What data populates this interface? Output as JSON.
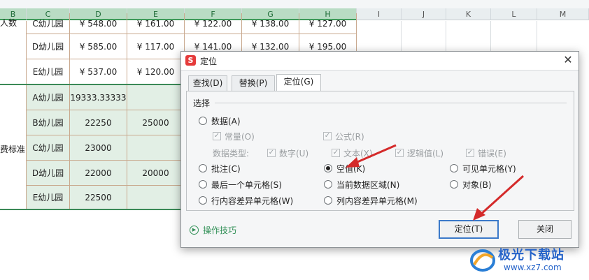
{
  "sheet": {
    "columns": [
      "B",
      "C",
      "D",
      "E",
      "F",
      "G",
      "H",
      "I",
      "J",
      "K",
      "L",
      "M"
    ],
    "group1_label": "人数",
    "group2_label": "费标准",
    "rows": [
      [
        "C幼儿园",
        "¥ 548.00",
        "¥ 161.00",
        "¥ 122.00",
        "¥ 138.00",
        "¥ 127.00"
      ],
      [
        "D幼儿园",
        "¥ 585.00",
        "¥ 117.00",
        "¥ 141.00",
        "¥ 132.00",
        "¥ 195.00"
      ],
      [
        "E幼儿园",
        "¥ 537.00",
        "¥ 120.00",
        "",
        "",
        ""
      ],
      [
        "A幼儿园",
        "19333.33333",
        "",
        "",
        "",
        ""
      ],
      [
        "B幼儿园",
        "22250",
        "25000",
        "",
        "",
        ""
      ],
      [
        "C幼儿园",
        "23000",
        "",
        "",
        "",
        ""
      ],
      [
        "D幼儿园",
        "22000",
        "20000",
        "",
        "",
        ""
      ],
      [
        "E幼儿园",
        "22500",
        "",
        "",
        "",
        ""
      ]
    ]
  },
  "dialog": {
    "title": "定位",
    "logo": "S",
    "close_label": "✕",
    "tabs": [
      "查找(D)",
      "替换(P)",
      "定位(G)"
    ],
    "active_tab": "定位(G)",
    "group_label": "选择",
    "options": {
      "data": "数据(A)",
      "constant": "常量(O)",
      "formula": "公式(R)",
      "data_type_label": "数据类型:",
      "number": "数字(U)",
      "text": "文本(X)",
      "logical": "逻辑值(L)",
      "error": "错误(E)",
      "comment": "批注(C)",
      "blank": "空值(K)",
      "visible": "可见单元格(Y)",
      "last_cell": "最后一个单元格(S)",
      "current_region": "当前数据区域(N)",
      "object": "对象(B)",
      "row_diff": "行内容差异单元格(W)",
      "col_diff": "列内容差异单元格(M)"
    },
    "selected_option": "空值(K)",
    "tips_label": "操作技巧",
    "ok_label": "定位(T)",
    "close_button_label": "关闭"
  },
  "watermark": {
    "name": "极光下载站",
    "url": "www.xz7.com"
  },
  "colors": {
    "accent_green": "#3b8a57",
    "arrow_red": "#d42a2a",
    "primary_border": "#3b79c9"
  }
}
